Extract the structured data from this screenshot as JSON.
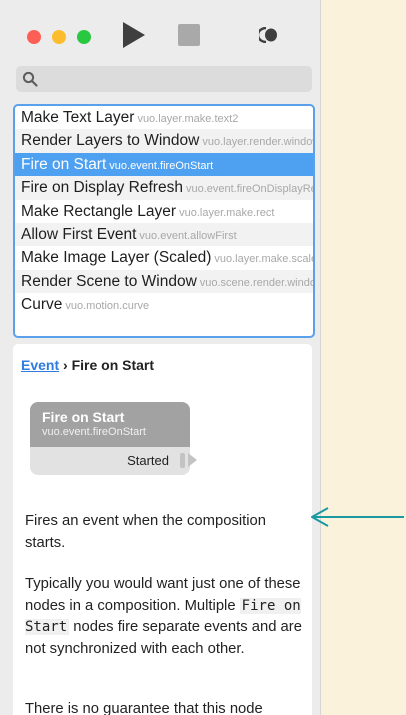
{
  "toolbar": {
    "lights": [
      {
        "name": "close",
        "color": "#fd5f57"
      },
      {
        "name": "minimize",
        "color": "#fdbc2e"
      },
      {
        "name": "zoom",
        "color": "#28c840"
      }
    ],
    "icons": [
      "play-icon",
      "stop-icon",
      "record-icon"
    ]
  },
  "search": {
    "icon": "search-icon",
    "value": ""
  },
  "node_list": [
    {
      "title": "Make Text Layer",
      "class": "vuo.layer.make.text2",
      "selected": false
    },
    {
      "title": "Render Layers to Window",
      "class": "vuo.layer.render.window",
      "selected": false
    },
    {
      "title": "Fire on Start",
      "class": "vuo.event.fireOnStart",
      "selected": true
    },
    {
      "title": "Fire on Display Refresh",
      "class": "vuo.event.fireOnDisplayRefresh",
      "selected": false
    },
    {
      "title": "Make Rectangle Layer",
      "class": "vuo.layer.make.rect",
      "selected": false
    },
    {
      "title": "Allow First Event",
      "class": "vuo.event.allowFirst",
      "selected": false
    },
    {
      "title": "Make Image Layer (Scaled)",
      "class": "vuo.layer.make.scaled",
      "selected": false
    },
    {
      "title": "Render Scene to Window",
      "class": "vuo.scene.render.window",
      "selected": false
    },
    {
      "title": "Curve",
      "class": "vuo.motion.curve",
      "selected": false
    }
  ],
  "doc": {
    "breadcrumb_link": "Event",
    "breadcrumb_sep": " › ",
    "breadcrumb_current": "Fire on Start",
    "node": {
      "title": "Fire on Start",
      "class": "vuo.event.fireOnStart",
      "port": "Started"
    },
    "para1": "Fires an event when the composition starts.",
    "para2_a": "Typically you would want just one of these nodes in a composition. Multiple ",
    "para2_code": "Fire on Start",
    "para2_b": " nodes fire separate events and are not synchronized with each other.",
    "para3": "There is no guarantee that this node"
  },
  "annotation": {
    "arrow_color": "#1a9aa0"
  }
}
